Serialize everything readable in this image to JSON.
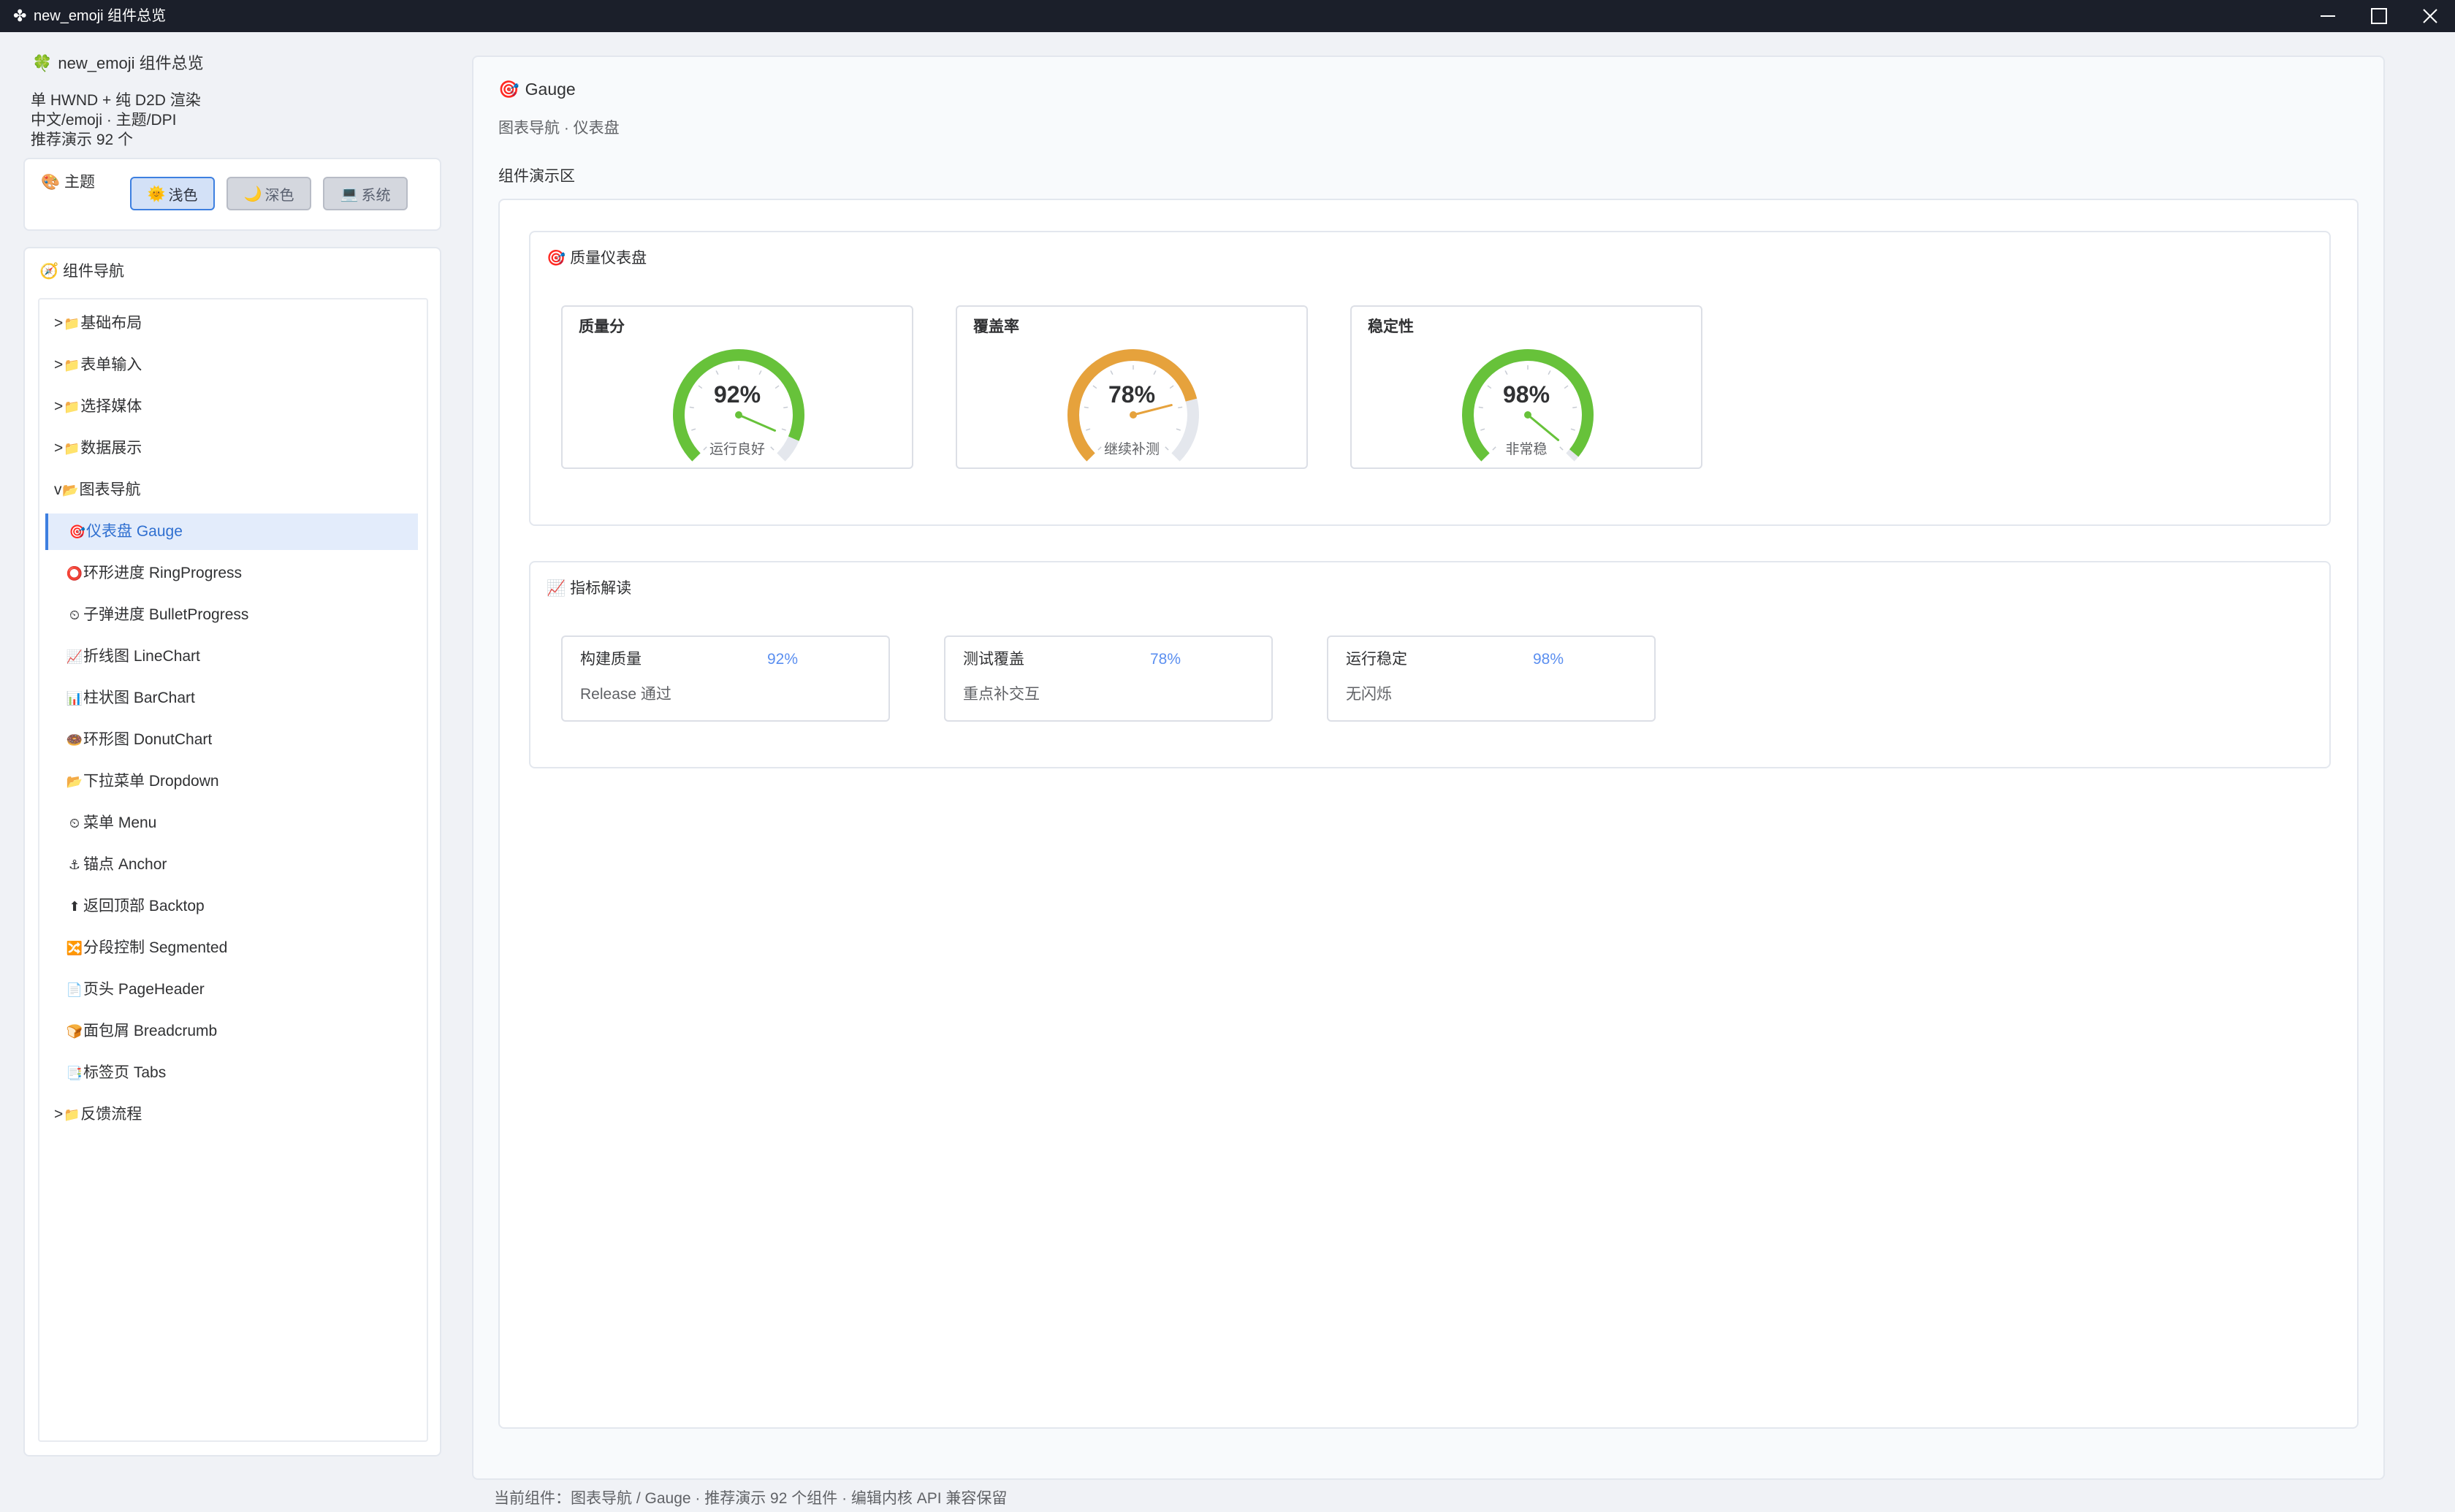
{
  "window": {
    "title": "new_emoji 组件总览",
    "icon": "clover-icon"
  },
  "sidebar": {
    "app_name": "new_emoji 组件总览",
    "info_lines": [
      "单 HWND + 纯 D2D 渲染",
      "中文/emoji · 主题/DPI",
      "推荐演示 92 个"
    ],
    "theme": {
      "label": "主题",
      "options": [
        {
          "label": "浅色",
          "glyph": "🌞",
          "selected": true
        },
        {
          "label": "深色",
          "glyph": "🌙",
          "selected": false
        },
        {
          "label": "系统",
          "glyph": "💻",
          "selected": false
        }
      ]
    },
    "nav": {
      "label": "组件导航",
      "items": [
        {
          "label": "基础布局",
          "type": "group",
          "prefix": ">",
          "glyph": "📁"
        },
        {
          "label": "表单输入",
          "type": "group",
          "prefix": ">",
          "glyph": "📁"
        },
        {
          "label": "选择媒体",
          "type": "group",
          "prefix": ">",
          "glyph": "📁"
        },
        {
          "label": "数据展示",
          "type": "group",
          "prefix": ">",
          "glyph": "📁"
        },
        {
          "label": "图表导航",
          "type": "group",
          "prefix": "v",
          "glyph": "📂"
        },
        {
          "label": "仪表盘 Gauge",
          "type": "child",
          "glyph": "🎯",
          "selected": true
        },
        {
          "label": "环形进度 RingProgress",
          "type": "child",
          "glyph": "⭕"
        },
        {
          "label": "子弹进度 BulletProgress",
          "type": "child",
          "glyph": "⏲"
        },
        {
          "label": "折线图 LineChart",
          "type": "child",
          "glyph": "📈"
        },
        {
          "label": "柱状图 BarChart",
          "type": "child",
          "glyph": "📊"
        },
        {
          "label": "环形图 DonutChart",
          "type": "child",
          "glyph": "🍩"
        },
        {
          "label": "下拉菜单 Dropdown",
          "type": "child",
          "glyph": "📂"
        },
        {
          "label": "菜单 Menu",
          "type": "child",
          "glyph": "⏲"
        },
        {
          "label": "锚点 Anchor",
          "type": "child",
          "glyph": "⚓"
        },
        {
          "label": "返回顶部 Backtop",
          "type": "child",
          "glyph": "⬆"
        },
        {
          "label": "分段控制 Segmented",
          "type": "child",
          "glyph": "🔀"
        },
        {
          "label": "页头 PageHeader",
          "type": "child",
          "glyph": "📄"
        },
        {
          "label": "面包屑 Breadcrumb",
          "type": "child",
          "glyph": "🍞"
        },
        {
          "label": "标签页 Tabs",
          "type": "child",
          "glyph": "📑"
        },
        {
          "label": "反馈流程",
          "type": "group",
          "prefix": ">",
          "glyph": "📁"
        }
      ]
    }
  },
  "main": {
    "title": "Gauge",
    "title_glyph": "🎯",
    "breadcrumb": "图表导航 · 仪表盘",
    "demo_label": "组件演示区",
    "gauge_section": {
      "title": "质量仪表盘",
      "glyph": "🎯",
      "gauges": [
        {
          "title": "质量分",
          "value": 92,
          "display": "92%",
          "caption": "运行良好",
          "color": "#67c23a"
        },
        {
          "title": "覆盖率",
          "value": 78,
          "display": "78%",
          "caption": "继续补测",
          "color": "#e6a23c"
        },
        {
          "title": "稳定性",
          "value": 98,
          "display": "98%",
          "caption": "非常稳",
          "color": "#67c23a"
        }
      ]
    },
    "metric_section": {
      "title": "指标解读",
      "glyph": "📈",
      "metrics": [
        {
          "name": "构建质量",
          "value": "92%",
          "desc": "Release 通过"
        },
        {
          "name": "测试覆盖",
          "value": "78%",
          "desc": "重点补交互"
        },
        {
          "name": "运行稳定",
          "value": "98%",
          "desc": "无闪烁"
        }
      ]
    }
  },
  "status": "当前组件：图表导航 / Gauge · 推荐演示 92 个组件 · 编辑内核 API 兼容保留",
  "colors": {
    "accent": "#3d7fe0",
    "track": "#e4e7ed",
    "metric_value": "#5b8ff0"
  }
}
